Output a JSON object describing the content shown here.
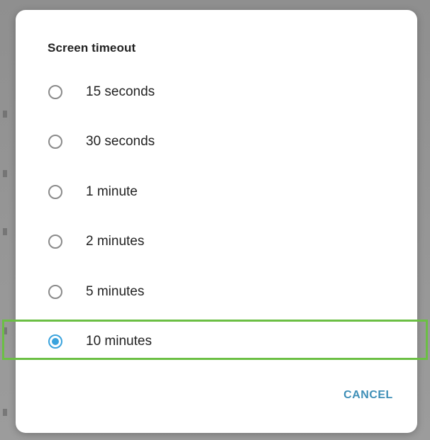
{
  "dialog": {
    "title": "Screen timeout",
    "options": [
      {
        "label": "15 seconds",
        "selected": false
      },
      {
        "label": "30 seconds",
        "selected": false
      },
      {
        "label": "1 minute",
        "selected": false
      },
      {
        "label": "2 minutes",
        "selected": false
      },
      {
        "label": "5 minutes",
        "selected": false
      },
      {
        "label": "10 minutes",
        "selected": true
      }
    ],
    "cancel_label": "CANCEL"
  },
  "colors": {
    "accent": "#3aa3dd",
    "cancel_text": "#3f8fb7",
    "highlight_border": "#6bbf44"
  }
}
